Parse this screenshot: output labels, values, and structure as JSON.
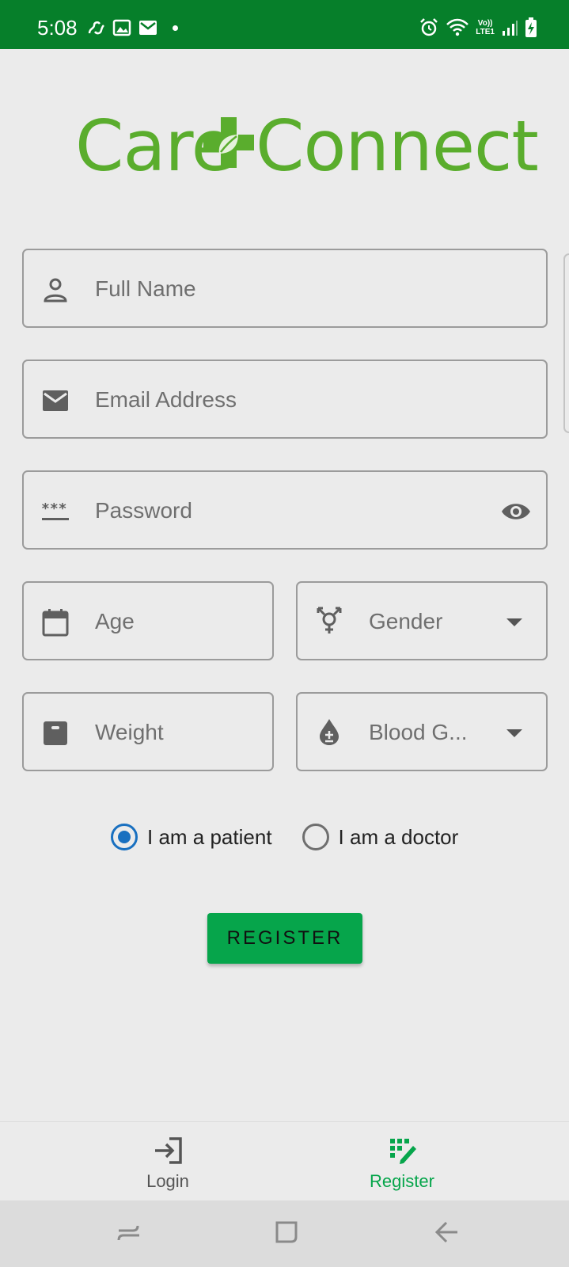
{
  "status_bar": {
    "time": "5:08",
    "left_icons": [
      "link-icon",
      "image-icon",
      "mail-icon",
      "dot-icon"
    ],
    "right_icons": [
      "alarm-icon",
      "wifi-icon",
      "volte-icon",
      "signal-icon",
      "battery-charging-icon"
    ],
    "volte_line1": "Vo))",
    "volte_line2": "LTE1"
  },
  "logo": {
    "part1": "Care",
    "part2": "Connect",
    "color": "#5aad2d"
  },
  "form": {
    "full_name": {
      "placeholder": "Full Name",
      "icon": "person-icon"
    },
    "email": {
      "placeholder": "Email Address",
      "icon": "email-icon"
    },
    "password": {
      "placeholder": "Password",
      "icon": "password-icon",
      "trailing_icon": "eye-icon"
    },
    "age": {
      "placeholder": "Age",
      "icon": "calendar-icon"
    },
    "gender": {
      "placeholder": "Gender",
      "icon": "gender-icon"
    },
    "weight": {
      "placeholder": "Weight",
      "icon": "weight-icon"
    },
    "blood_group": {
      "placeholder": "Blood G...",
      "icon": "blood-drop-icon"
    },
    "role_options": [
      {
        "label": "I am a patient",
        "selected": true
      },
      {
        "label": "I am a doctor",
        "selected": false
      }
    ],
    "register_button": "REGISTER"
  },
  "bottom_nav": {
    "items": [
      {
        "label": "Login",
        "icon": "login-icon",
        "active": false
      },
      {
        "label": "Register",
        "icon": "register-icon",
        "active": true
      }
    ]
  },
  "colors": {
    "status_bar": "#067f2a",
    "accent": "#06a54b",
    "radio_selected": "#1970c0",
    "background": "#ebebeb"
  }
}
